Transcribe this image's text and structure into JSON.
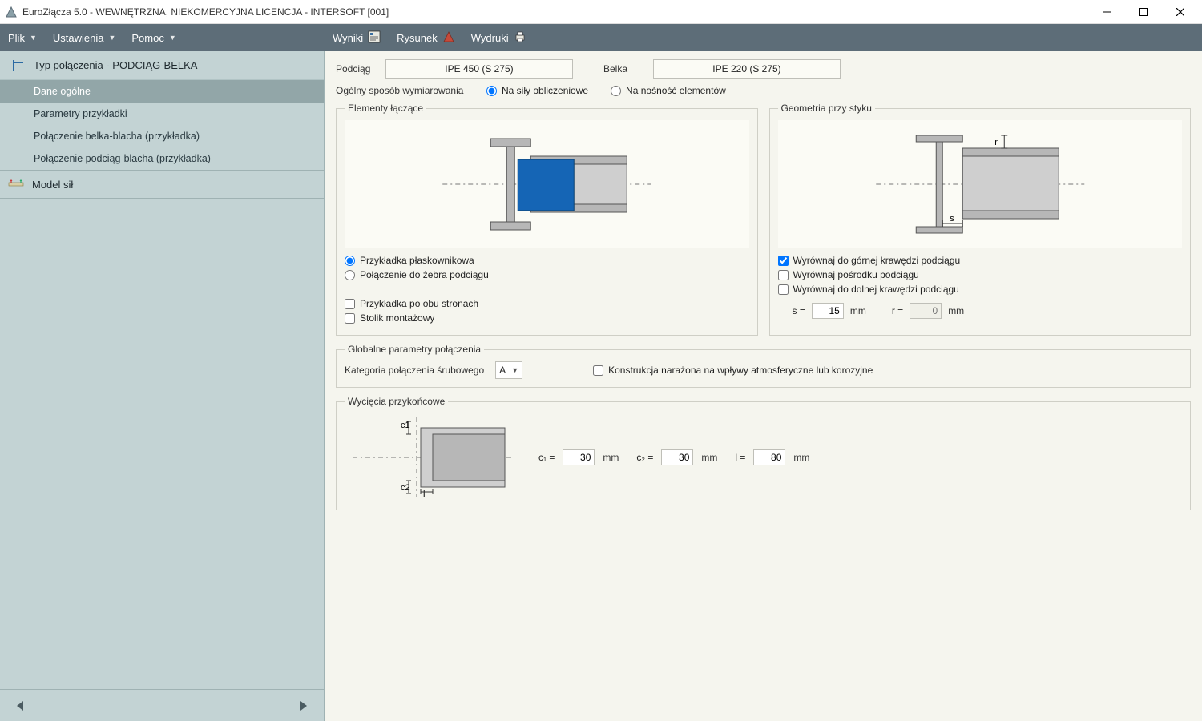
{
  "window": {
    "title": "EuroZłącza 5.0 - WEWNĘTRZNA, NIEKOMERCYJNA LICENCJA - INTERSOFT [001]"
  },
  "menu": {
    "plik": "Plik",
    "ustawienia": "Ustawienia",
    "pomoc": "Pomoc",
    "wyniki": "Wyniki",
    "rysunek": "Rysunek",
    "wydruki": "Wydruki"
  },
  "sidebar": {
    "connection_type_label": "Typ połączenia - PODCIĄG-BELKA",
    "items": [
      {
        "label": "Dane ogólne"
      },
      {
        "label": "Parametry przykładki"
      },
      {
        "label": "Połączenie belka-blacha (przykładka)"
      },
      {
        "label": "Połączenie podciąg-blacha (przykładka)"
      }
    ],
    "model_sil": "Model sił"
  },
  "form": {
    "podciag_label": "Podciąg",
    "podciag_value": "IPE 450 (S 275)",
    "belka_label": "Belka",
    "belka_value": "IPE 220 (S 275)",
    "dim_method_label": "Ogólny sposób wymiarowania",
    "dim_method_opt1": "Na siły obliczeniowe",
    "dim_method_opt2": "Na nośność elementów",
    "elementy_title": "Elementy łączące",
    "elem_opt1": "Przykładka płaskownikowa",
    "elem_opt2": "Połączenie do żebra podciągu",
    "elem_chk1": "Przykładka po obu stronach",
    "elem_chk2": "Stolik montażowy",
    "geom_title": "Geometria przy styku",
    "geom_chk1": "Wyrównaj do górnej krawędzi podciągu",
    "geom_chk2": "Wyrównaj pośrodku podciągu",
    "geom_chk3": "Wyrównaj do dolnej krawędzi podciągu",
    "s_label": "s  =",
    "s_value": "15",
    "r_label": "r  =",
    "r_value": "0",
    "mm": "mm",
    "global_title": "Globalne parametry połączenia",
    "kategoria_label": "Kategoria połączenia śrubowego",
    "kategoria_value": "A",
    "korozja_label": "Konstrukcja narażona na wpływy atmosferyczne lub korozyjne",
    "wyciecia_title": "Wycięcia przykońcowe",
    "c1_label": "c₁  =",
    "c1_value": "30",
    "c2_label": "c₂  =",
    "c2_value": "30",
    "l_label": "l  =",
    "l_value": "80"
  }
}
